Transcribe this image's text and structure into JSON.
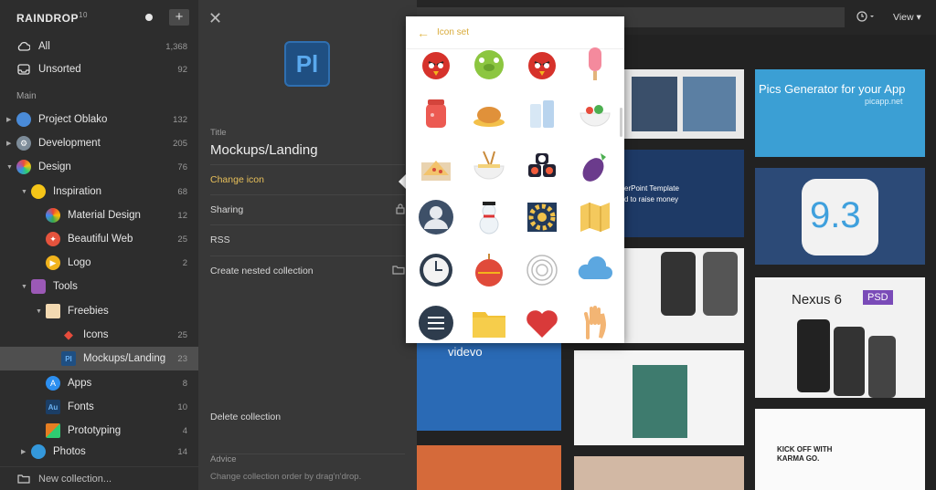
{
  "sidebar": {
    "brand": "RAINDROP",
    "brand_version": "10",
    "header_items": [
      {
        "label": "All",
        "count": "1,368"
      },
      {
        "label": "Unsorted",
        "count": "92"
      }
    ],
    "section_label": "Main",
    "tree": [
      {
        "label": "Project Oblako",
        "count": "132"
      },
      {
        "label": "Development",
        "count": "205"
      },
      {
        "label": "Design",
        "count": "76"
      },
      {
        "label": "Inspiration",
        "count": "68"
      },
      {
        "label": "Material Design",
        "count": "12"
      },
      {
        "label": "Beautiful Web",
        "count": "25"
      },
      {
        "label": "Logo",
        "count": "2"
      },
      {
        "label": "Tools",
        "count": ""
      },
      {
        "label": "Freebies",
        "count": ""
      },
      {
        "label": "Icons",
        "count": "25"
      },
      {
        "label": "Mockups/Landing",
        "count": "23"
      },
      {
        "label": "Apps",
        "count": "8"
      },
      {
        "label": "Fonts",
        "count": "10"
      },
      {
        "label": "Prototyping",
        "count": "4"
      },
      {
        "label": "Photos",
        "count": "14"
      }
    ],
    "footer": "New collection..."
  },
  "editor": {
    "icon_text": "Pl",
    "title_label": "Title",
    "title_value": "Mockups/Landing",
    "change_icon": "Change icon",
    "sharing": "Sharing",
    "rss": "RSS",
    "nested": "Create nested collection",
    "delete": "Delete collection",
    "advice_label": "Advice",
    "advice_text": "Change collection order by drag'n'drop."
  },
  "topbar": {
    "view_label": "View"
  },
  "cards": {
    "pics_title": "Pics Generator for your App",
    "pics_sub": "picapp.net",
    "powerpoint_1": "erPoint Template",
    "powerpoint_2": "d to raise money",
    "ios": "9.3",
    "nexus": "Nexus 6",
    "psd": "PSD",
    "videvo": "videvo",
    "karma_1": "KICK OFF WITH",
    "karma_2": "KARMA GO."
  },
  "popup": {
    "title": "Icon set",
    "icons": [
      "angry-bird-red-icon",
      "green-pig-icon",
      "angry-bird-red-icon",
      "popsicle-icon",
      "jar-icon",
      "roast-chicken-icon",
      "milk-bottles-icon",
      "salad-bowl-icon",
      "pizza-box-icon",
      "noodle-bowl-icon",
      "sushi-icon",
      "eggplant-icon",
      "user-avatar-icon",
      "snowman-icon",
      "gear-icon",
      "map-icon",
      "clock-icon",
      "ornament-icon",
      "fingerprint-icon",
      "cloud-icon",
      "menu-circle-icon",
      "folder-icon",
      "heart-icon",
      "hand-icon"
    ]
  },
  "colors": {
    "sidebar_bg": "#2d2d2d",
    "editor_bg": "#383838",
    "accent": "#d9ab3a",
    "active_row": "#4f4f4f"
  }
}
